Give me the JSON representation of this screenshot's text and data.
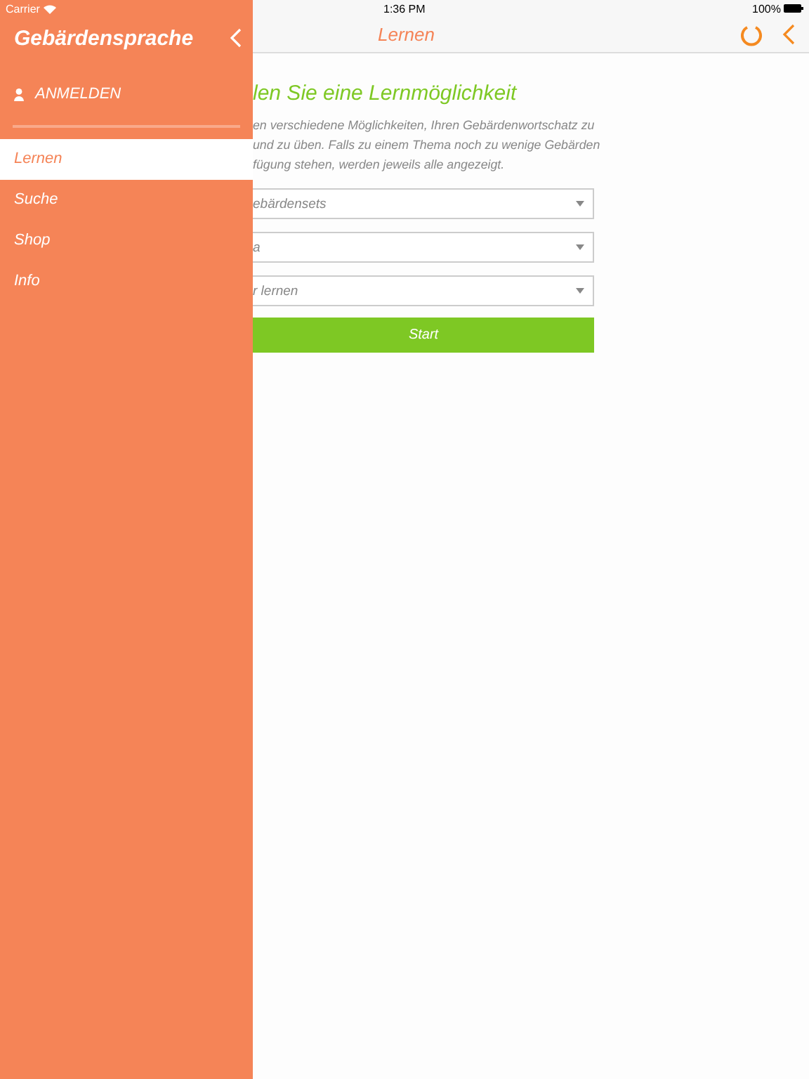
{
  "status_bar": {
    "carrier": "Carrier",
    "time": "1:36 PM",
    "battery": "100%"
  },
  "drawer": {
    "title": "Gebärdensprache",
    "login": "ANMELDEN",
    "items": [
      {
        "label": "Lernen",
        "selected": true
      },
      {
        "label": "Suche",
        "selected": false
      },
      {
        "label": "Shop",
        "selected": false
      },
      {
        "label": "Info",
        "selected": false
      }
    ]
  },
  "nav_bar": {
    "title": "Lernen"
  },
  "content": {
    "heading": "len Sie eine Lernmöglichkeit",
    "intro_lines": [
      "en verschiedene Möglichkeiten, Ihren Gebärdenwortschatz zu",
      "und zu üben. Falls zu einem Thema noch zu wenige Gebärden",
      "fügung stehen, werden jeweils alle angezeigt."
    ],
    "selects": [
      {
        "value": "ebärdensets"
      },
      {
        "value": "a"
      },
      {
        "value": "r lernen"
      }
    ],
    "start_button": "Start"
  }
}
